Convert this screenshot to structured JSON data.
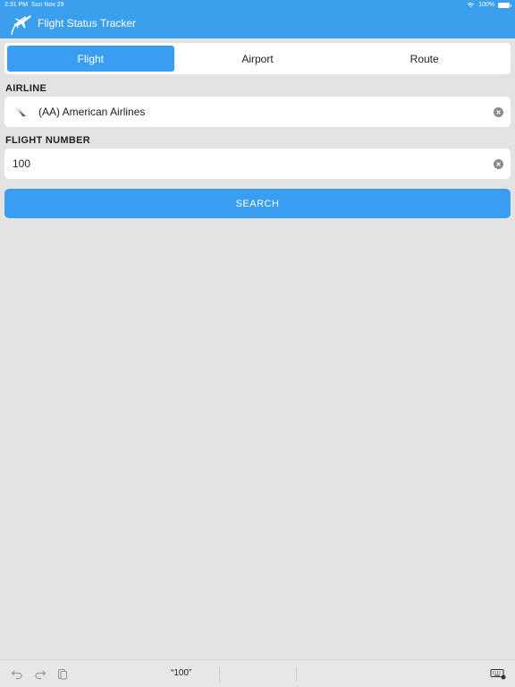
{
  "status_bar": {
    "time": "2:31 PM",
    "date": "Sun Nov 29",
    "battery": "100%"
  },
  "header": {
    "title": "Flight Status Tracker"
  },
  "tabs": [
    {
      "label": "Flight",
      "active": true
    },
    {
      "label": "Airport",
      "active": false
    },
    {
      "label": "Route",
      "active": false
    }
  ],
  "airline": {
    "label": "AIRLINE",
    "value": "(AA) American Airlines"
  },
  "flight_number": {
    "label": "FLIGHT NUMBER",
    "value": "100"
  },
  "search": {
    "label": "SEARCH"
  },
  "keyboard_bar": {
    "suggestion": "“100”"
  },
  "colors": {
    "accent": "#3a9ef0",
    "header": "#3aa0ee",
    "background": "#e3e3e3"
  }
}
